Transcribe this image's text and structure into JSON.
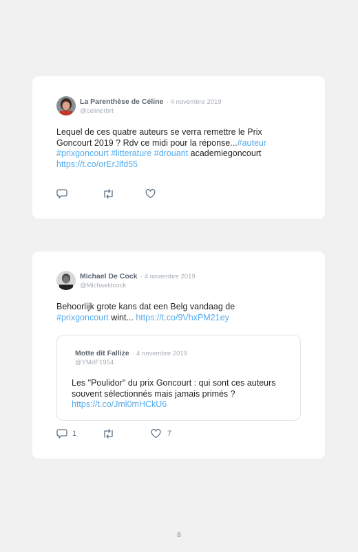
{
  "tweets": [
    {
      "author": "La Parenthèse de Céline",
      "date": "· 4 novembre 2019",
      "handle": "@celinerbrt",
      "text_parts": [
        {
          "t": "Lequel de ces quatre auteurs se verra remettre le Prix Goncourt 2019 ? Rdv ce midi pour la réponse..."
        },
        {
          "t": "#auteur",
          "link": true
        },
        {
          "t": " "
        },
        {
          "t": "#prixgoncourt",
          "link": true
        },
        {
          "t": " "
        },
        {
          "t": "#litterature",
          "link": true
        },
        {
          "t": " "
        },
        {
          "t": "#drouant",
          "link": true
        },
        {
          "t": " academiegoncourt "
        },
        {
          "t": "https://t.co/orErJlfd55",
          "link": true
        }
      ]
    },
    {
      "author": "Michael De Cock",
      "date": "· 4 novembre 2019",
      "handle": "@Michaeldcock",
      "text_parts": [
        {
          "t": "Behoorlijk grote kans dat een Belg vandaag de "
        },
        {
          "t": "#prixgoncourt",
          "link": true
        },
        {
          "t": " wint... "
        },
        {
          "t": "https://t.co/9VhxPM21ey",
          "link": true
        }
      ],
      "replies": "1",
      "likes": "7",
      "quote": {
        "author": "Motte dit Fallize",
        "date": "· 4 novembre 2019",
        "handle": "@YMdF1954",
        "text_parts": [
          {
            "t": "Les \"Poulidor\" du prix Goncourt : qui sont ces auteurs souvent sélectionnés mais jamais primés ? "
          },
          {
            "t": "https://t.co/Jml0mHCkU6",
            "link": true
          }
        ]
      }
    }
  ],
  "page_number": "8",
  "colors": {
    "link": "#55acee",
    "background": "#f1f1f2",
    "card": "#ffffff"
  },
  "icons": [
    "reply-icon",
    "retweet-icon",
    "like-icon"
  ]
}
